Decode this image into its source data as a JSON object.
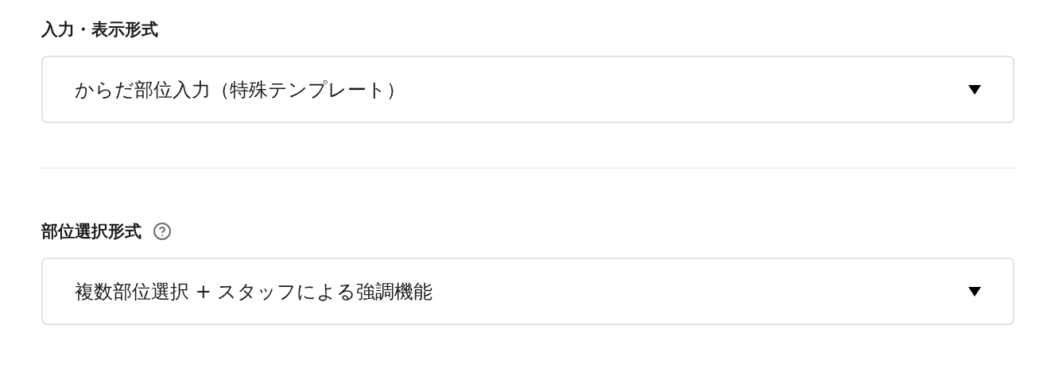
{
  "sections": [
    {
      "label": "入力・表示形式",
      "help": false,
      "value": "からだ部位入力（特殊テンプレート）"
    },
    {
      "label": "部位選択形式",
      "help": true,
      "value": "複数部位選択 + スタッフによる強調機能"
    }
  ]
}
